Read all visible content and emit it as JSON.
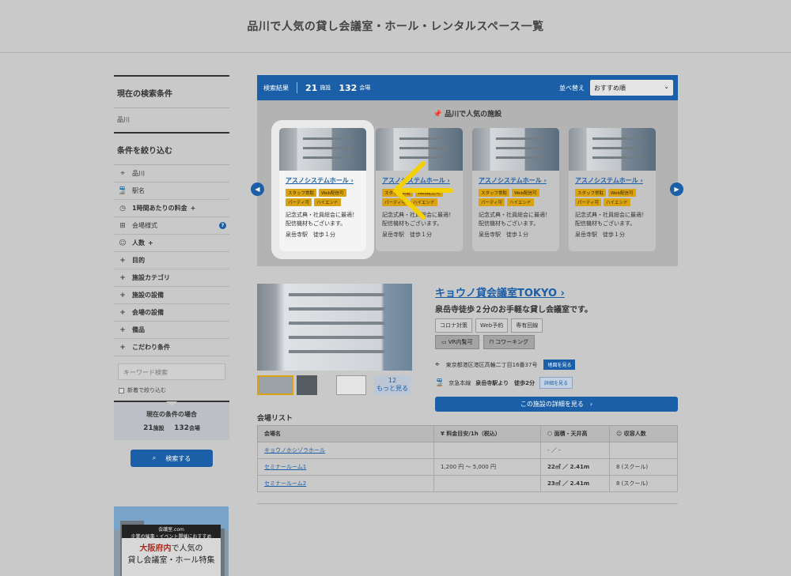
{
  "page": {
    "title": "品川で人気の貸し会議室・ホール・レンタルスペース一覧"
  },
  "sidebar": {
    "current_heading": "現在の検索条件",
    "current_value": "品川",
    "filter_heading": "条件を絞り込む",
    "items": [
      {
        "label": "品川",
        "icon": "pin-icon"
      },
      {
        "label": "駅名",
        "icon": "train-icon"
      },
      {
        "label": "1時間あたりの料金",
        "icon": "clock-icon",
        "plus": "+"
      },
      {
        "label": "会場様式",
        "icon": "layout-icon",
        "help": "?"
      },
      {
        "label": "人数",
        "icon": "people-icon",
        "plus": "+"
      },
      {
        "label": "目的",
        "icon": "plus-icon"
      },
      {
        "label": "施設カテゴリ",
        "icon": "plus-icon"
      },
      {
        "label": "施設の設備",
        "icon": "plus-icon"
      },
      {
        "label": "会場の設備",
        "icon": "plus-icon"
      },
      {
        "label": "備品",
        "icon": "plus-icon"
      },
      {
        "label": "こだわり条件",
        "icon": "plus-icon"
      }
    ],
    "keyword_placeholder": "キーワード検索",
    "new_only": "新着で絞り込む",
    "cond_title": "現在の条件の場合",
    "cond_facilities": "21",
    "cond_facilities_unit": "施設",
    "cond_venues": "132",
    "cond_venues_unit": "会場",
    "search_button": "検索する",
    "banner": {
      "label": "企業の催事・イベント開催におすすめ",
      "logo": "会議室.com",
      "line1_highlight": "大阪府内",
      "line1_rest": "で人気の",
      "line2": "貸し会議室・ホール特集"
    }
  },
  "results": {
    "label": "検索結果",
    "facilities": "21",
    "facilities_unit": "施設",
    "venues": "132",
    "venues_unit": "会場",
    "sort_label": "並べ替え",
    "sort_value": "おすすめ順"
  },
  "popular": {
    "title": "品川で人気の施設",
    "cards": [
      {
        "name": "アスノシステムホール",
        "tags": [
          "スタッフ常駐",
          "Web配信可",
          "パーティ可",
          "ハイエンド"
        ],
        "desc": "記念式典・社員総会に最適！ 配信機材もございます。",
        "station": "泉岳寺駅　徒歩１分"
      },
      {
        "name": "アスノシステムホール",
        "tags": [
          "スタッフ常駐",
          "Web配信可",
          "パーティ可",
          "ハイエンド"
        ],
        "desc": "記念式典・社員総会に最適！ 配信機材もございます。",
        "station": "泉岳寺駅　徒歩１分"
      },
      {
        "name": "アスノシステムホール",
        "tags": [
          "スタッフ常駐",
          "Web配信可",
          "パーティ可",
          "ハイエンド"
        ],
        "desc": "記念式典・社員総会に最適！ 配信機材もございます。",
        "station": "泉岳寺駅　徒歩１分"
      },
      {
        "name": "アスノシステムホール",
        "tags": [
          "スタッフ常駐",
          "Web配信可",
          "パーティ可",
          "ハイエンド"
        ],
        "desc": "記念式典・社員総会に最適！ 配信機材もございます。",
        "station": "泉岳寺駅　徒歩１分"
      }
    ]
  },
  "facility": {
    "name": "キョウノ貸会議室TOKYO",
    "catch": "泉岳寺徒歩２分のお手軽な貸し会議室です。",
    "tags": [
      "コロナ対策",
      "Web予約",
      "専有回線"
    ],
    "tags2": [
      "VR内覧可",
      "コワーキング"
    ],
    "address": "東京都港区港区高輪二丁目16番37号",
    "map_button": "地図を見る",
    "line": "京急本線",
    "station": "泉岳寺駅より　徒歩2分",
    "route_button": "詳細を見る",
    "more_count": "12",
    "more_label": "もっと見る",
    "detail_button": "この施設の詳細を見る　›"
  },
  "venue_list": {
    "title": "会場リスト",
    "headers": [
      "会場名",
      "料金目安/1h（税込）",
      "面積・天井高",
      "収容人数"
    ],
    "rows": [
      {
        "name": "キョウノホシゾラホール",
        "price": "",
        "area": "- ／ -",
        "cap": ""
      },
      {
        "name": "セミナールーム1",
        "price": "1,200 円 〜 5,000 円",
        "area": "22㎡ ／ 2.41m",
        "cap": "8 (スクール)"
      },
      {
        "name": "セミナールーム2",
        "price": "",
        "area": "23㎡ ／ 2.41m",
        "cap": "8 (スクール)"
      }
    ]
  }
}
